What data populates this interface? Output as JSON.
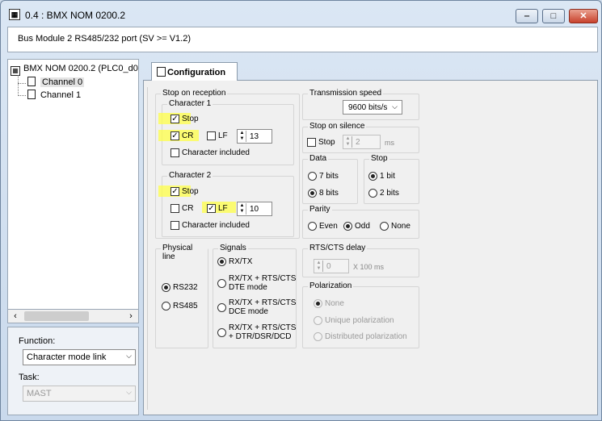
{
  "window": {
    "title": "0.4 : BMX NOM 0200.2"
  },
  "header": {
    "description": "Bus Module 2 RS485/232 port (SV >= V1.2)"
  },
  "tree": {
    "root": "BMX NOM 0200.2 (PLC0_d0",
    "children": [
      {
        "label": "Channel 0"
      },
      {
        "label": "Channel 1"
      }
    ]
  },
  "function": {
    "label": "Function:",
    "value": "Character mode link"
  },
  "task": {
    "label": "Task:",
    "value": "MAST"
  },
  "tab": {
    "label": "Configuration"
  },
  "stop_on_reception": {
    "title": "Stop on reception",
    "char1": {
      "title": "Character 1",
      "stop_label": "Stop",
      "stop_checked": true,
      "cr_label": "CR",
      "cr_checked": true,
      "lf_label": "LF",
      "lf_checked": false,
      "lf_value": "13",
      "included_label": "Character included",
      "included_checked": false
    },
    "char2": {
      "title": "Character 2",
      "stop_label": "Stop",
      "stop_checked": true,
      "cr_label": "CR",
      "cr_checked": false,
      "lf_label": "LF",
      "lf_checked": true,
      "lf_value": "10",
      "included_label": "Character included",
      "included_checked": false
    }
  },
  "transmission_speed": {
    "title": "Transmission speed",
    "value": "9600 bits/s"
  },
  "stop_on_silence": {
    "title": "Stop on silence",
    "stop_label": "Stop",
    "stop_checked": false,
    "value": "2",
    "unit": "ms"
  },
  "data_bits": {
    "title": "Data",
    "options": [
      "7 bits",
      "8 bits"
    ],
    "selected": "8 bits"
  },
  "stop_bits": {
    "title": "Stop",
    "options": [
      "1 bit",
      "2 bits"
    ],
    "selected": "1 bit"
  },
  "parity": {
    "title": "Parity",
    "options": [
      "Even",
      "Odd",
      "None"
    ],
    "selected": "Odd"
  },
  "physical_line": {
    "title": "Physical line",
    "options": [
      "RS232",
      "RS485"
    ],
    "selected": "RS232"
  },
  "signals": {
    "title": "Signals",
    "options": [
      {
        "line1": "RX/TX",
        "line2": ""
      },
      {
        "line1": "RX/TX + RTS/CTS",
        "line2": "DTE mode"
      },
      {
        "line1": "RX/TX + RTS/CTS",
        "line2": "DCE mode"
      },
      {
        "line1": "RX/TX + RTS/CTS",
        "line2": "+ DTR/DSR/DCD"
      }
    ],
    "selected_index": 0
  },
  "rts_cts_delay": {
    "title": "RTS/CTS delay",
    "value": "0",
    "unit": "X 100 ms"
  },
  "polarization": {
    "title": "Polarization",
    "options": [
      "None",
      "Unique polarization",
      "Distributed polarization"
    ],
    "selected": "None"
  },
  "colors": {
    "highlight": "#ffff3c",
    "titlebar": "#dbe7f4",
    "close_button": "#c8422c"
  }
}
